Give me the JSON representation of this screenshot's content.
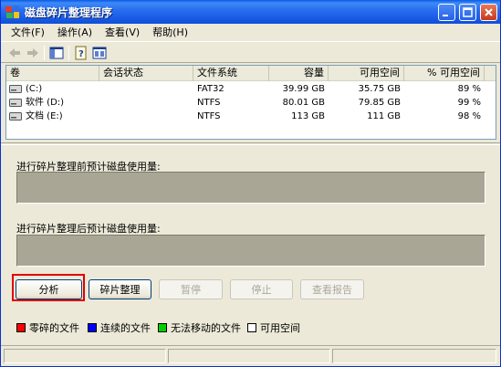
{
  "window": {
    "title": "磁盘碎片整理程序",
    "controls": {
      "minimize": "_",
      "maximize": "□",
      "close": "×"
    }
  },
  "menu": [
    {
      "label": "文件(F)"
    },
    {
      "label": "操作(A)"
    },
    {
      "label": "查看(V)"
    },
    {
      "label": "帮助(H)"
    }
  ],
  "toolbar": {
    "icons": [
      "back-arrow-icon",
      "forward-arrow-icon",
      "show-hide-console-tree-icon",
      "help-icon",
      "properties-icon"
    ]
  },
  "volume_list": {
    "columns": [
      "卷",
      "会话状态",
      "文件系统",
      "容量",
      "可用空间",
      "% 可用空间"
    ],
    "rows": [
      {
        "volume": "(C:)",
        "session": "",
        "fs": "FAT32",
        "capacity": "39.99 GB",
        "free": "35.75 GB",
        "percent": "89 %"
      },
      {
        "volume": "软件 (D:)",
        "session": "",
        "fs": "NTFS",
        "capacity": "80.01 GB",
        "free": "79.85 GB",
        "percent": "99 %"
      },
      {
        "volume": "文档 (E:)",
        "session": "",
        "fs": "NTFS",
        "capacity": "113 GB",
        "free": "111 GB",
        "percent": "98 %"
      }
    ]
  },
  "usage": {
    "before_label": "进行碎片整理前预计磁盘使用量:",
    "after_label": "进行碎片整理后预计磁盘使用量:"
  },
  "buttons": {
    "analyze": "分析",
    "defrag": "碎片整理",
    "pause": "暂停",
    "stop": "停止",
    "report": "查看报告"
  },
  "legend": [
    {
      "label": "零碎的文件",
      "color": "#ff0000"
    },
    {
      "label": "连续的文件",
      "color": "#0000ff"
    },
    {
      "label": "无法移动的文件",
      "color": "#00d000"
    },
    {
      "label": "可用空间",
      "color": "#ffffff"
    }
  ],
  "colors": {
    "titlebar": "#0a58ea",
    "highlight": "#e00000",
    "usage_box": "#a9a696"
  }
}
